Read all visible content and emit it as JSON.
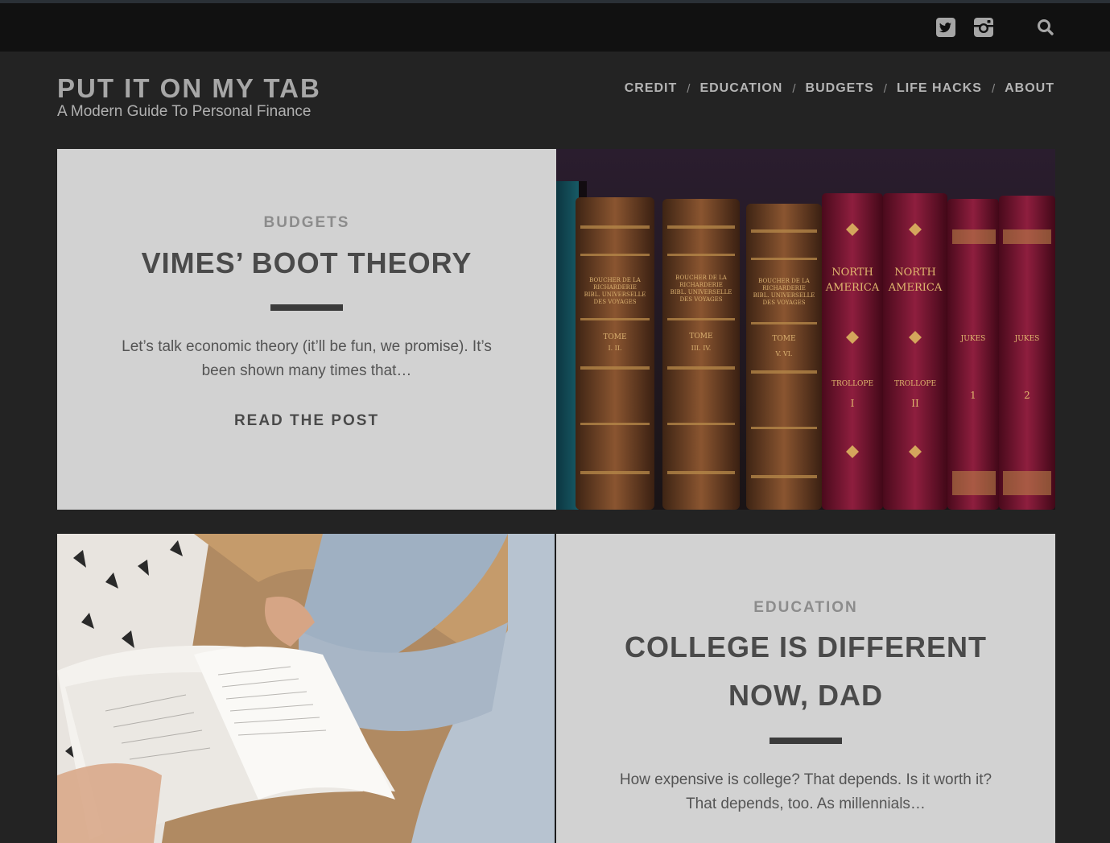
{
  "site": {
    "title": "PUT IT ON MY TAB",
    "tagline": "A Modern Guide To Personal Finance"
  },
  "topbar": {
    "icons": [
      "twitter-icon",
      "instagram-icon",
      "search-icon"
    ]
  },
  "nav": {
    "items": [
      {
        "label": "CREDIT"
      },
      {
        "label": "EDUCATION"
      },
      {
        "label": "BUDGETS"
      },
      {
        "label": "LIFE HACKS"
      },
      {
        "label": "ABOUT"
      }
    ],
    "separator": "/"
  },
  "posts": [
    {
      "category": "BUDGETS",
      "title": "VIMES’ BOOT THEORY",
      "excerpt": "Let’s talk economic theory (it’ll be fun, we promise). It’s been shown many times that…",
      "cta": "READ THE POST",
      "image": {
        "subject": "antique-books-on-shelf",
        "spine_labels": [
          "BOUCHER DE LA RICHARDERIE",
          "TOME I. II.",
          "TOME III. IV.",
          "TOME V. VI.",
          "NORTH AMERICA",
          "TROLLOPE",
          "I",
          "II",
          "JUKES"
        ]
      }
    },
    {
      "category": "EDUCATION",
      "title": "COLLEGE IS DIFFERENT NOW, DAD",
      "excerpt": "How expensive is college? That depends. Is it worth it? That depends, too. As millennials…",
      "image": {
        "subject": "person-reading-book"
      }
    }
  ],
  "colors": {
    "page_bg": "#232323",
    "topbar_bg": "#111111",
    "card_bg": "#d2d2d2",
    "accent_rule": "#3b3b3b"
  }
}
